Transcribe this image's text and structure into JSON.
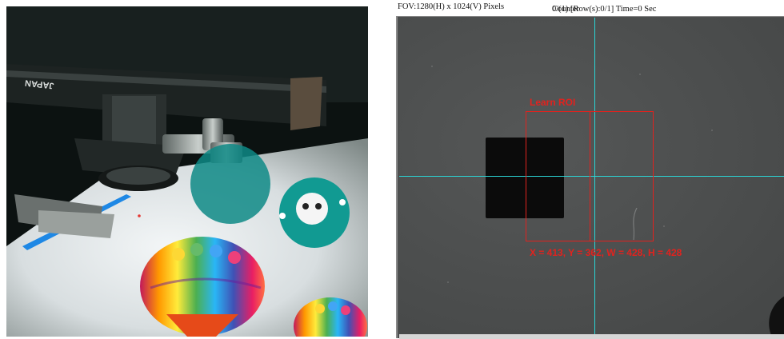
{
  "left_panel": {
    "photo_text": "JAPAN"
  },
  "viewer": {
    "fov_label": "FOV:1280(H) x 1024(V) Pixels",
    "counter_label": "Counter",
    "counter_value": "0/(1) [Row(s):0/1] Time=0 Sec",
    "roi_label": "Learn ROI",
    "roi_coords": "X = 413, Y = 362, W = 428, H = 428",
    "colors": {
      "crosshair": "#2bd6d6",
      "roi": "#e1221e"
    }
  }
}
